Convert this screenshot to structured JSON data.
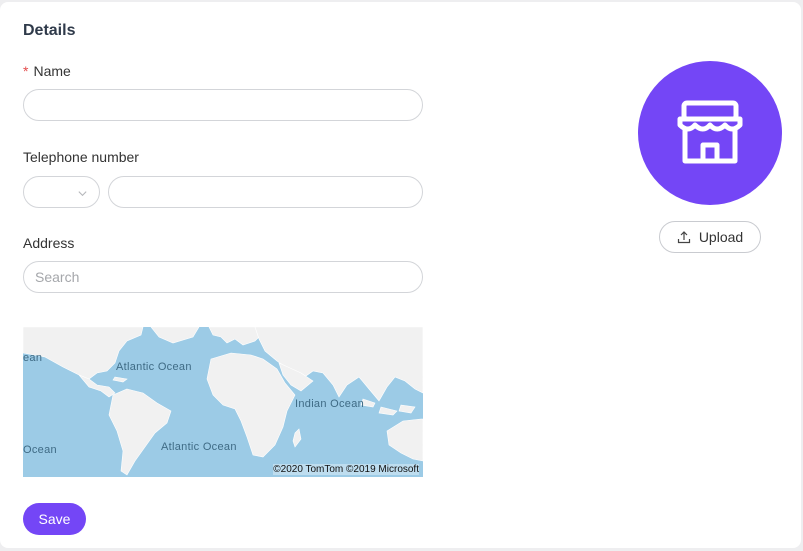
{
  "form": {
    "title": "Details",
    "name": {
      "required_mark": "*",
      "label": "Name",
      "value": ""
    },
    "telephone": {
      "label": "Telephone number",
      "country_code": "",
      "value": ""
    },
    "address": {
      "label": "Address",
      "placeholder": "Search"
    },
    "save_label": "Save"
  },
  "map": {
    "labels": [
      "ean",
      "Atlantic Ocean",
      "Indian Ocean",
      "Ocean",
      "Atlantic Ocean"
    ],
    "copyright": "©2020 TomTom ©2019 Microsoft",
    "colors": {
      "water": "#9ccbe6",
      "land": "#f1f1f1"
    }
  },
  "avatar": {
    "icon": "store-icon",
    "color": "#7446f6"
  },
  "upload": {
    "icon": "upload-icon",
    "label": "Upload"
  }
}
